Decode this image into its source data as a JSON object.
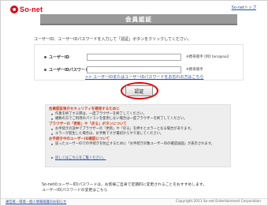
{
  "header": {
    "logo_text": "So-net",
    "top_link": "So-netトップ"
  },
  "title": "会員認証",
  "intro": "ユーザーID、ユーザーIDパスワードを入力して「認証」ボタンをクリックしてください。",
  "form": {
    "user_id_label": "ユーザーID",
    "user_id_value": "",
    "user_id_note": "※携帯版手 [例] taro@aa2",
    "password_label": "ユーザーIDパスワード",
    "password_value": "",
    "password_note": "※携帯版手",
    "forgot_link": ">> ユーザーIDまたはユーザーIDパスワードをお忘れの方はこちら"
  },
  "auth_button": "認証",
  "notice": {
    "section1_title": "会員認証後のセキュリティを確保するために",
    "section1_items": [
      "作業を終了する際は、一度ブラウザーを終了してください。",
      "複数の方でご利用のパソコンを使用しない場合は一度ブラウザーを終了してください。"
    ],
    "section2_title": "ブラウザーの「更新」や「戻る」ボタンについて",
    "section2_items": [
      "お手続きの途中でブラウザーの「更新」や「戻る」を押すとエラーとなる場合があります。",
      "エラーが発生した場合は、お手数ですが最初からやり直してください。"
    ],
    "section3_title": "お手続き中のユーザーID確認について",
    "section3_items": [
      "誤ったユーザーIDでの手続きを防止するために「お手続き対象ユーザーIDの確認画面」が表示されます。"
    ],
    "section3_link": "詳しくはこちらをご覧ください。"
  },
  "footnote": {
    "line1": "So-netのユーザーID/パスワードは、お客様ご自身で定期的に変更されることをおすすめします。",
    "line2": "ユーザーID/パスワードの変更はこちら"
  },
  "footer": {
    "link": "運営者・環境・個人情報保護のお知らせ",
    "copyright": "Copyright 2011 So-net Entertainment Corporation"
  }
}
